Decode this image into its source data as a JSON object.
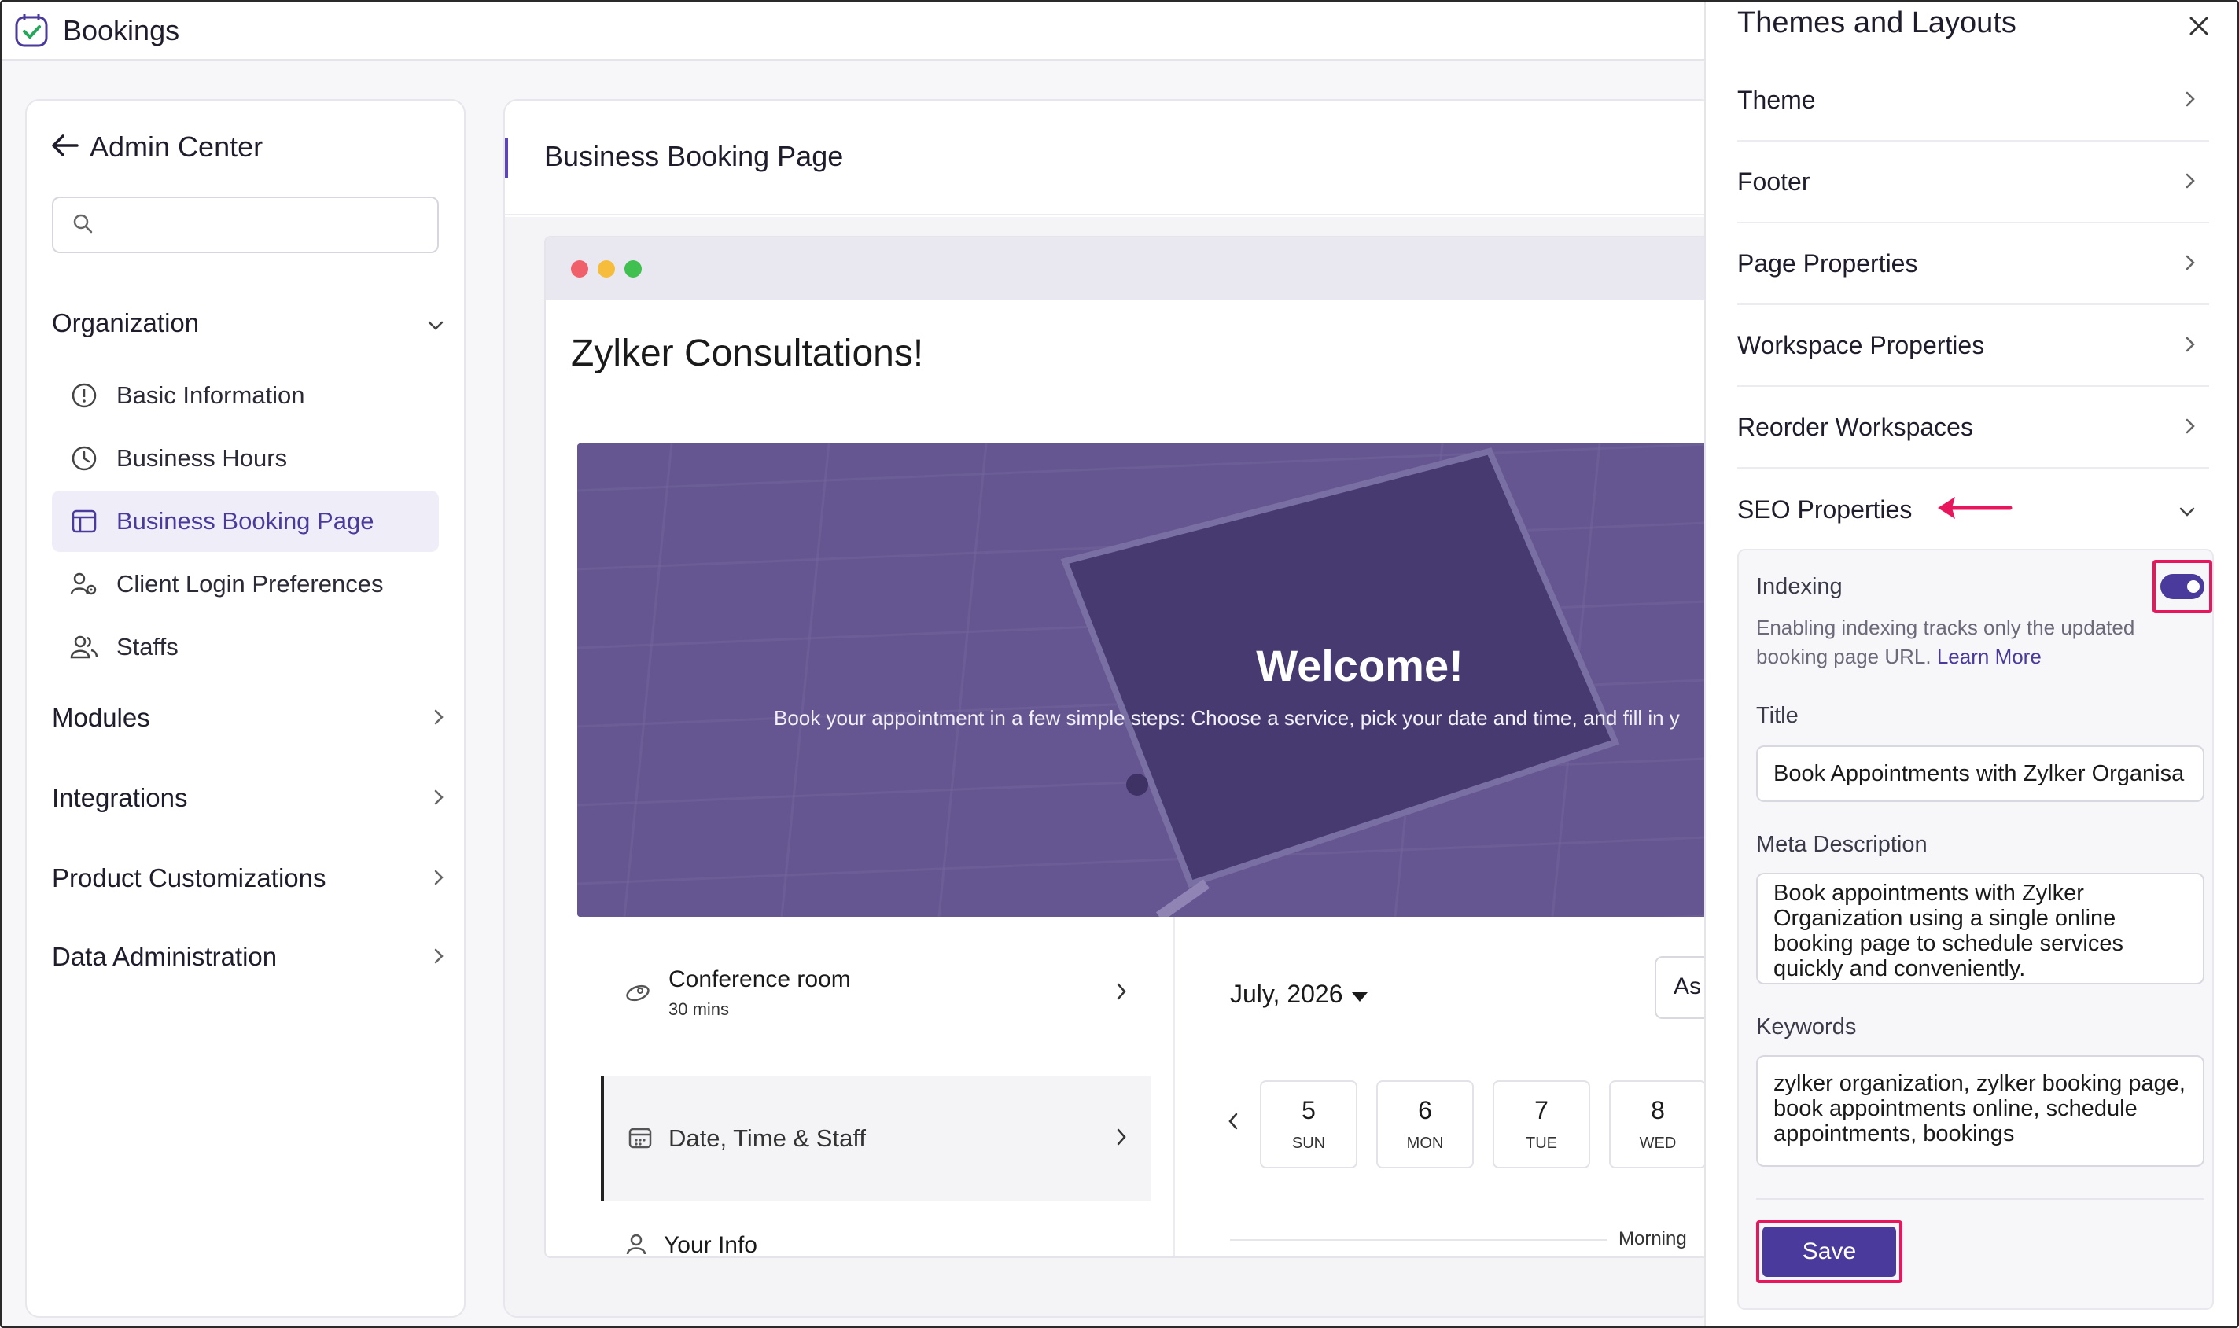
{
  "app": {
    "title": "Bookings"
  },
  "left_panel": {
    "back_label": "Admin Center",
    "search": {
      "placeholder": "",
      "value": ""
    },
    "sections": [
      {
        "label": "Organization",
        "expanded": true
      },
      {
        "label": "Modules"
      },
      {
        "label": "Integrations"
      },
      {
        "label": "Product Customizations"
      },
      {
        "label": "Data Administration"
      }
    ],
    "org_items": [
      {
        "label": "Basic Information",
        "icon": "info-circle-icon"
      },
      {
        "label": "Business Hours",
        "icon": "clock-icon"
      },
      {
        "label": "Business Booking Page",
        "icon": "page-layout-icon",
        "active": true
      },
      {
        "label": "Client Login Preferences",
        "icon": "user-settings-icon"
      },
      {
        "label": "Staffs",
        "icon": "users-icon"
      }
    ]
  },
  "main": {
    "title": "Business Booking Page",
    "preview": {
      "site_title": "Zylker Consultations!",
      "hero_title": "Welcome!",
      "hero_subtitle": "Book your appointment in a few simple steps: Choose a service, pick your date and time, and fill in y",
      "steps": [
        {
          "label": "Conference room",
          "sub": "30 mins"
        },
        {
          "label": "Date, Time & Staff"
        },
        {
          "label": "Your Info"
        }
      ],
      "calendar": {
        "month": "July, 2026",
        "button": "As",
        "days": [
          {
            "num": "5",
            "weekday": "SUN"
          },
          {
            "num": "6",
            "weekday": "MON"
          },
          {
            "num": "7",
            "weekday": "TUE"
          },
          {
            "num": "8",
            "weekday": "WED"
          }
        ],
        "period": "Morning"
      }
    }
  },
  "drawer": {
    "title": "Themes and Layouts",
    "rows": [
      {
        "label": "Theme"
      },
      {
        "label": "Footer"
      },
      {
        "label": "Page Properties"
      },
      {
        "label": "Workspace Properties"
      },
      {
        "label": "Reorder Workspaces"
      },
      {
        "label": "SEO Properties",
        "expanded": true
      }
    ],
    "seo": {
      "indexing_label": "Indexing",
      "indexing_on": true,
      "help_text": "Enabling indexing tracks only the updated booking page URL.",
      "learn_more": "Learn More",
      "title_label": "Title",
      "title_value": "Book Appointments with Zylker Organisa",
      "meta_label": "Meta Description",
      "meta_value": "Book appointments with Zylker Organization using a single online booking page to schedule services quickly and conveniently.",
      "keywords_label": "Keywords",
      "keywords_value": "zylker organization, zylker booking page, book appointments online, schedule appointments,  bookings",
      "save_label": "Save"
    }
  },
  "colors": {
    "accent": "#4a3a9c",
    "highlight": "#e8175d",
    "hero": "#6a5b94"
  }
}
